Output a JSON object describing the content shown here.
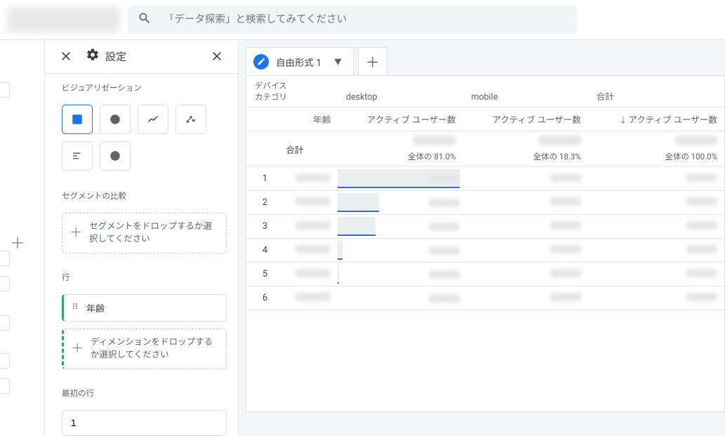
{
  "search": {
    "placeholder": "「データ探索」と検索してみてください"
  },
  "settings": {
    "title": "設定",
    "viz_label": "ビジュアリゼーション",
    "segment_label": "セグメントの比較",
    "segment_drop": "セグメントをドロップするか選択してください",
    "rows_label": "行",
    "row_chip": "年齢",
    "dimension_drop": "ディメンションをドロップするか選択してください",
    "first_row_label": "最初の行",
    "first_row_value": "1"
  },
  "tab": {
    "name": "自由形式 1"
  },
  "table": {
    "device_category_label": "デバイス\nカテゴリ",
    "cols": [
      "desktop",
      "mobile",
      "合計"
    ],
    "age_label": "年齢",
    "metric_label": "アクティブ ユーザー数",
    "total_label": "合計",
    "total_pcts": [
      "全体の 81.0%",
      "全体の 18.3%",
      "全体の 100.0%"
    ],
    "rows": [
      1,
      2,
      3,
      4,
      5,
      6
    ],
    "bar_widths_pct": [
      100,
      34,
      31,
      4,
      1,
      0
    ]
  }
}
